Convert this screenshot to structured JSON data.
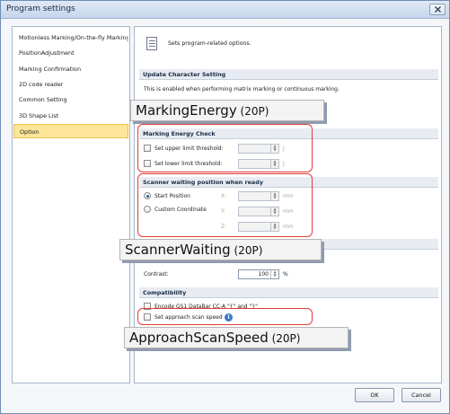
{
  "window": {
    "title": "Program settings"
  },
  "sidebar": {
    "items": [
      {
        "label": "Motionless Marking/On-the-fly Marking"
      },
      {
        "label": "PositionAdjustment"
      },
      {
        "label": "Marking Confirmation"
      },
      {
        "label": "2D code reader"
      },
      {
        "label": "Common Setting"
      },
      {
        "label": "3D Shape List"
      },
      {
        "label": "Option",
        "selected": true
      }
    ]
  },
  "main": {
    "header_text": "Sets program-related options.",
    "update_character": {
      "title": "Update Character Setting",
      "description": "This is enabled when performing matrix marking or continuous marking."
    },
    "marking_energy": {
      "title": "Marking Energy Check",
      "upper_label": "Set upper limit threshold:",
      "lower_label": "Set lower limit threshold:",
      "unit": "J"
    },
    "scanner_waiting": {
      "title": "Scanner waiting position when ready",
      "start_position": "Start Position",
      "custom_coordinate": "Custom Coordinate",
      "x_label": "X:",
      "y_label": "Y:",
      "z_label": "Z:",
      "unit": "mm"
    },
    "contrast": {
      "label": "Contrast:",
      "value": "100",
      "unit": "%"
    },
    "compatibility": {
      "title": "Compatibility",
      "encode_gs1": "Encode GS1 DataBar CC-A \"{\" and \"}\"",
      "approach_speed": "Set approach scan speed"
    }
  },
  "callouts": {
    "marking_energy": {
      "name": "MarkingEnergy",
      "suffix": " (20P)"
    },
    "scanner_waiting": {
      "name": "ScannerWaiting",
      "suffix": " (20P)"
    },
    "approach_speed": {
      "name": "ApproachScanSpeed",
      "suffix": " (20P)"
    }
  },
  "footer": {
    "ok_label": "OK",
    "cancel_label": "Cancel"
  },
  "colors": {
    "highlight": "#e23a3a",
    "selected": "#fde59a",
    "info": "#3b7bd1"
  }
}
